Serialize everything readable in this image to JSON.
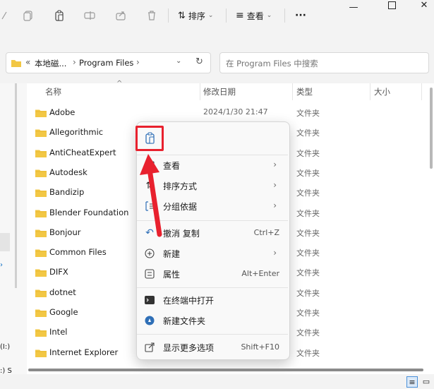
{
  "toolbar": {
    "sort_label": "排序",
    "view_label": "查看",
    "more_label": "···"
  },
  "address": {
    "overflow": "«",
    "crumb1": "本地磁...",
    "sep1": "›",
    "crumb2": "Program Files",
    "sep2": "›"
  },
  "search": {
    "placeholder": "在 Program Files 中搜索"
  },
  "columns": {
    "name": "名称",
    "date": "修改日期",
    "type": "类型",
    "size": "大小"
  },
  "files": [
    {
      "name": "Adobe",
      "date": "2024/1/30 21:47",
      "type": "文件夹"
    },
    {
      "name": "Allegorithmic",
      "date": "",
      "type": "文件夹"
    },
    {
      "name": "AntiCheatExpert",
      "date": "",
      "type": "文件夹"
    },
    {
      "name": "Autodesk",
      "date": "",
      "type": "文件夹"
    },
    {
      "name": "Bandizip",
      "date": "",
      "type": "文件夹"
    },
    {
      "name": "Blender Foundation",
      "date": "",
      "type": "文件夹"
    },
    {
      "name": "Bonjour",
      "date": "",
      "type": "文件夹"
    },
    {
      "name": "Common Files",
      "date": "",
      "type": "文件夹"
    },
    {
      "name": "DIFX",
      "date": "",
      "type": "文件夹"
    },
    {
      "name": "dotnet",
      "date": "",
      "type": "文件夹"
    },
    {
      "name": "Google",
      "date": "",
      "type": "文件夹"
    },
    {
      "name": "Intel",
      "date": "",
      "type": "文件夹"
    },
    {
      "name": "Internet Explorer",
      "date": "",
      "type": "文件夹"
    }
  ],
  "context_menu": {
    "view": "查看",
    "sort": "排序方式",
    "group": "分组依据",
    "undo": "撤消 复制",
    "undo_shortcut": "Ctrl+Z",
    "new": "新建",
    "properties": "属性",
    "properties_shortcut": "Alt+Enter",
    "terminal": "在终端中打开",
    "new_folder": "新建文件夹",
    "more_options": "显示更多选项",
    "more_shortcut": "Shift+F10"
  },
  "leftpane": {
    "drive1": "(I:)",
    "drive2": ":) S"
  },
  "colors": {
    "accent": "#0067c0",
    "folder": "#f2c744",
    "highlight": "#e8212e"
  }
}
